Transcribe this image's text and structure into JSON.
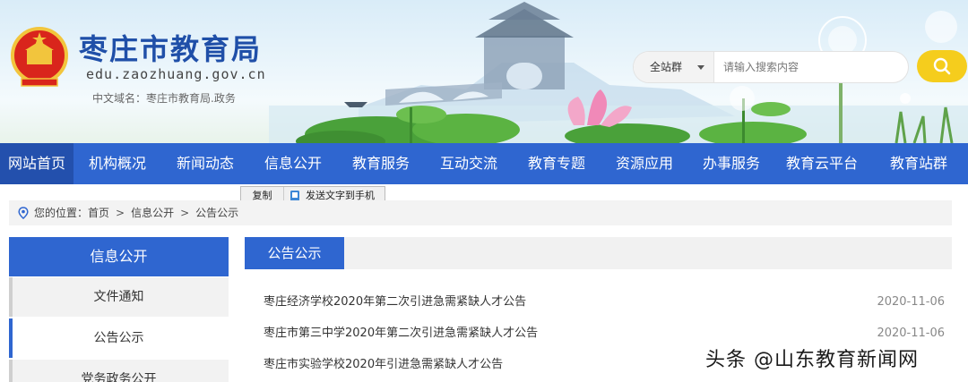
{
  "header": {
    "title": "枣庄市教育局",
    "domain": "edu.zaozhuang.gov.cn",
    "cn_domain": "中文域名：枣庄市教育局.政务"
  },
  "search": {
    "scope": "全站群",
    "placeholder": "请输入搜索内容"
  },
  "nav": {
    "items": [
      {
        "label": "网站首页"
      },
      {
        "label": "机构概况"
      },
      {
        "label": "新闻动态"
      },
      {
        "label": "信息公开"
      },
      {
        "label": "教育服务"
      },
      {
        "label": "互动交流"
      },
      {
        "label": "教育专题"
      },
      {
        "label": "资源应用"
      },
      {
        "label": "办事服务"
      },
      {
        "label": "教育云平台"
      },
      {
        "label": "教育站群"
      }
    ]
  },
  "popup": {
    "copy": "复制",
    "send": "发送文字到手机"
  },
  "breadcrumb": {
    "prefix": "您的位置：",
    "items": [
      "首页",
      "信息公开",
      "公告公示"
    ]
  },
  "sidebar": {
    "title": "信息公开",
    "items": [
      {
        "label": "文件通知"
      },
      {
        "label": "公告公示"
      },
      {
        "label": "党务政务公开"
      }
    ]
  },
  "main": {
    "tab": "公告公示",
    "list": [
      {
        "title": "枣庄经济学校2020年第二次引进急需紧缺人才公告",
        "date": "2020-11-06"
      },
      {
        "title": "枣庄市第三中学2020年第二次引进急需紧缺人才公告",
        "date": "2020-11-06"
      },
      {
        "title": "枣庄市实验学校2020年引进急需紧缺人才公告",
        "date": ""
      }
    ]
  },
  "watermark": "头条 @山东教育新闻网",
  "colors": {
    "primary": "#2f66d0",
    "primary_dark": "#2350ad",
    "title_blue": "#1f4fa8",
    "search_button": "#f5cd1d"
  }
}
